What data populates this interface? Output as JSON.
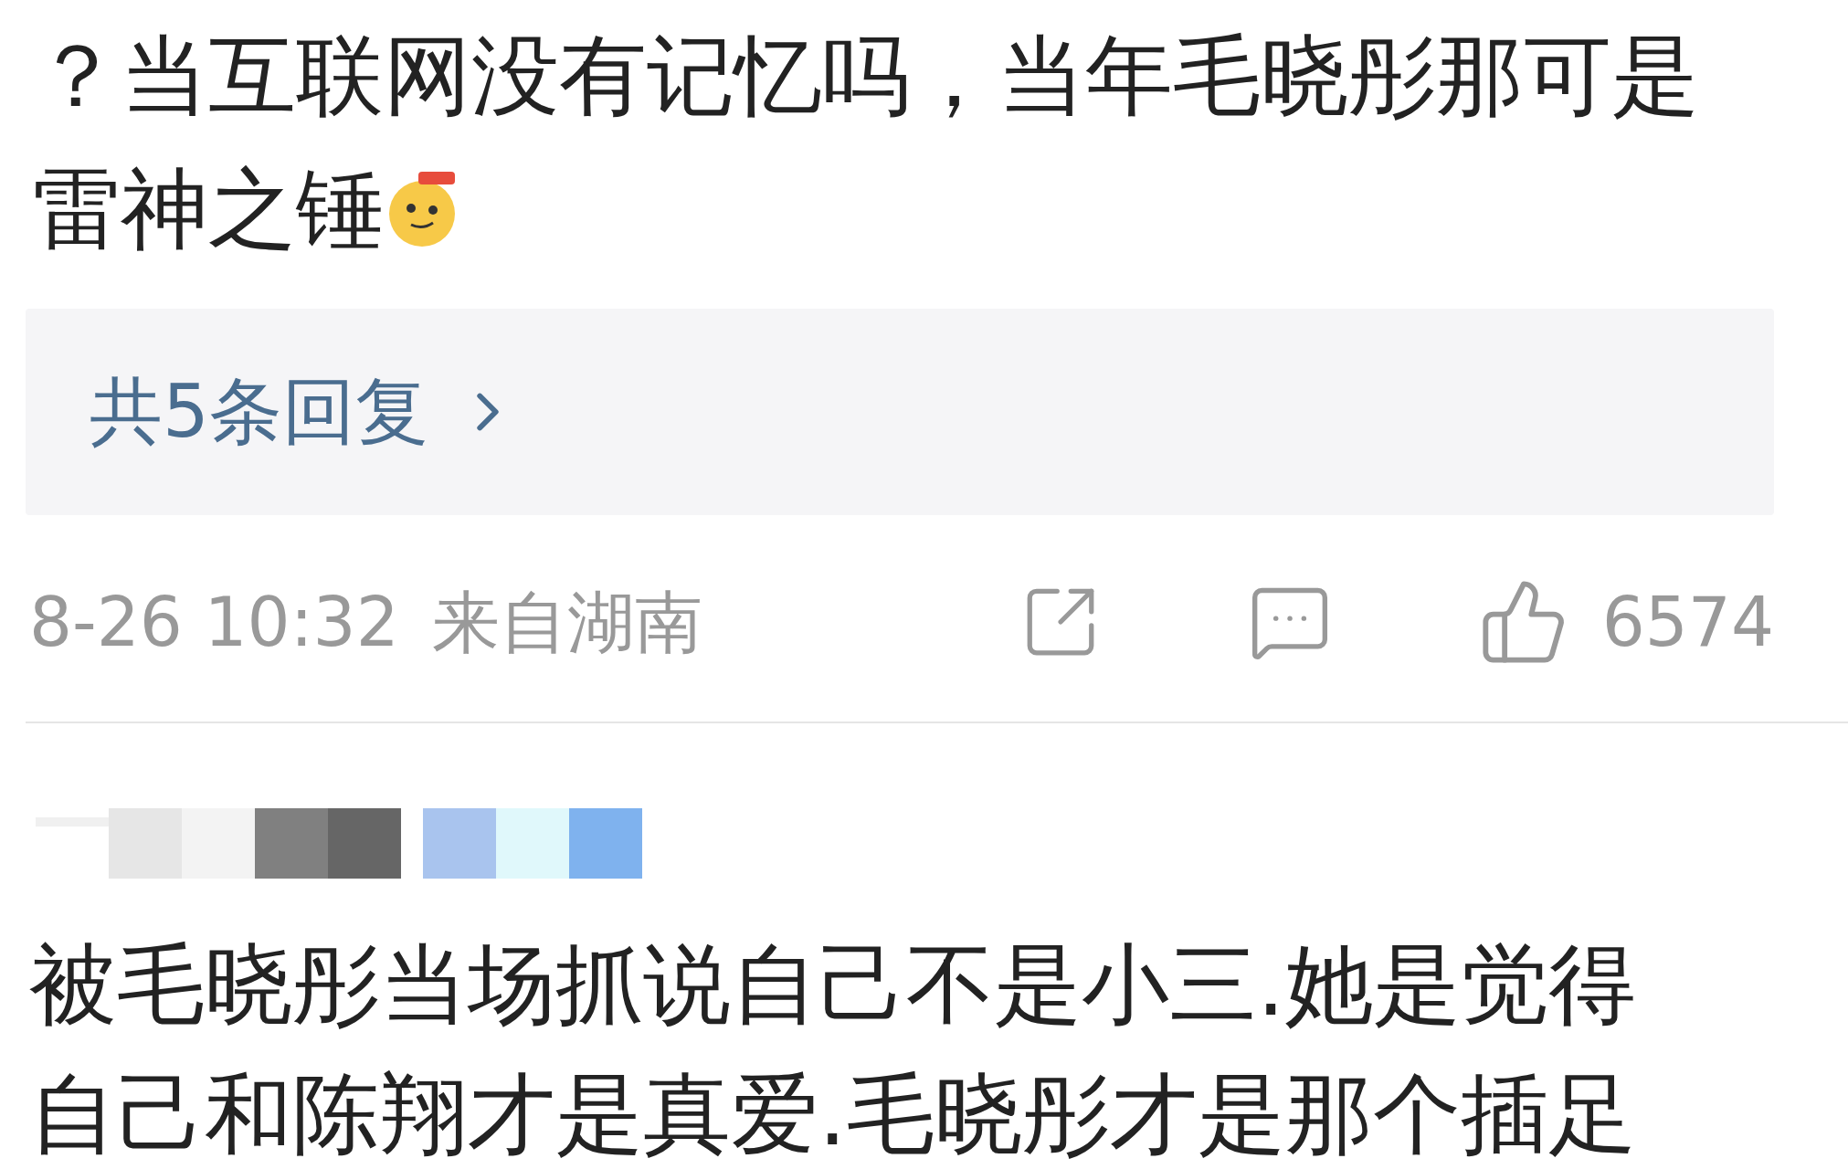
{
  "comment": {
    "lines": [
      "？当互联网没有记忆吗，当年毛晓彤那可是",
      "雷神之锤"
    ],
    "replies_link": "共5条回复",
    "meta": {
      "date": "8-26 10:32",
      "location": "来自湖南",
      "likes": "6574"
    }
  },
  "next_comment": {
    "lines": [
      "被毛晓彤当场抓说自己不是小三.她是觉得",
      "自己和陈翔才是真爱.毛晓彤才是那个插足"
    ]
  }
}
